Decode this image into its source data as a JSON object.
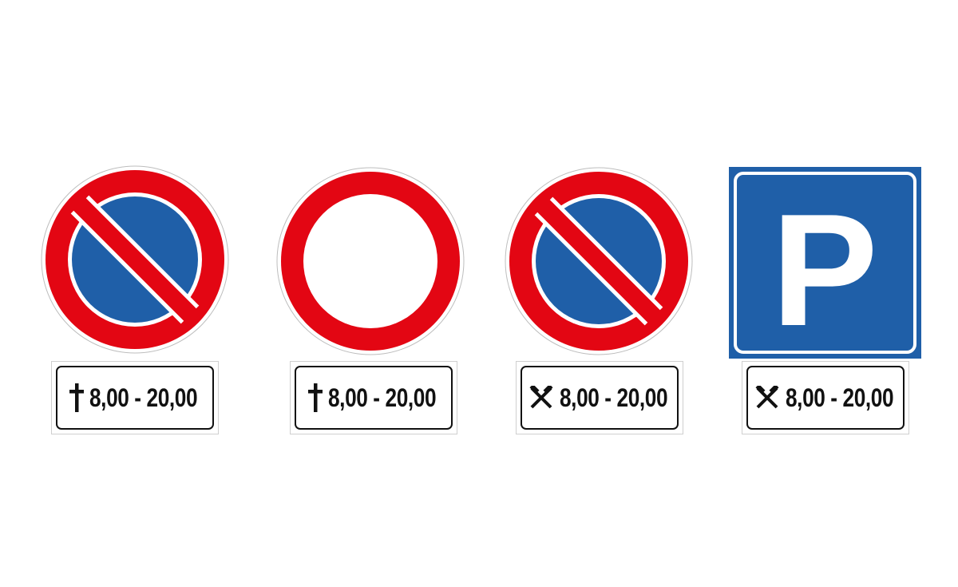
{
  "colors": {
    "red": "#e30613",
    "blue": "#1f5fa8",
    "white": "#ffffff",
    "black": "#111111"
  },
  "signs": [
    {
      "id": "no-parking-1",
      "sign_icon": "no-parking-sign",
      "plate_icon": "cross-icon",
      "plate_text": "8,00 - 20,00"
    },
    {
      "id": "no-vehicles",
      "sign_icon": "no-vehicles-sign",
      "plate_icon": "cross-icon",
      "plate_text": "8,00 - 20,00"
    },
    {
      "id": "no-parking-2",
      "sign_icon": "no-parking-sign",
      "plate_icon": "hammers-icon",
      "plate_text": "8,00 - 20,00"
    },
    {
      "id": "parking",
      "sign_icon": "parking-sign",
      "sign_letter": "P",
      "plate_icon": "hammers-icon",
      "plate_text": "8,00 - 20,00"
    }
  ]
}
